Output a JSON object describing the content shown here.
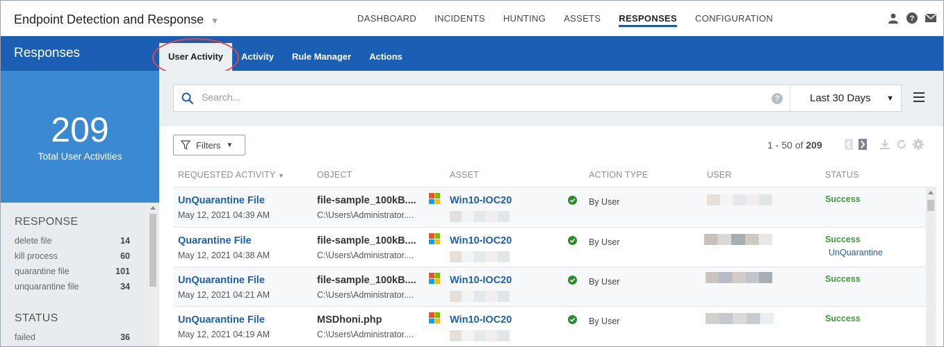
{
  "app": {
    "title": "Endpoint Detection and Response"
  },
  "topnav": [
    "DASHBOARD",
    "INCIDENTS",
    "HUNTING",
    "ASSETS",
    "RESPONSES",
    "CONFIGURATION"
  ],
  "topnav_active": "RESPONSES",
  "top_icons": [
    "user-icon",
    "help-icon",
    "mail-icon"
  ],
  "section": {
    "title": "Responses"
  },
  "subtabs": [
    "User Activity",
    "Activity",
    "Rule Manager",
    "Actions"
  ],
  "subtab_active": "User Activity",
  "stats": {
    "count": "209",
    "label": "Total User Activities"
  },
  "facets": {
    "response": {
      "title": "RESPONSE",
      "items": [
        {
          "label": "delete file",
          "count": "14"
        },
        {
          "label": "kill process",
          "count": "60"
        },
        {
          "label": "quarantine file",
          "count": "101"
        },
        {
          "label": "unquarantine file",
          "count": "34"
        }
      ]
    },
    "status": {
      "title": "STATUS",
      "items": [
        {
          "label": "failed",
          "count": "36"
        }
      ]
    }
  },
  "search": {
    "placeholder": "Search...",
    "value": "",
    "date_range": "Last 30 Days"
  },
  "toolbar": {
    "filters_label": "Filters",
    "pager_text": "1 - 50 of",
    "pager_total": "209"
  },
  "columns": [
    "REQUESTED ACTIVITY",
    "OBJECT",
    "ASSET",
    "ACTION TYPE",
    "USER",
    "STATUS"
  ],
  "rows": [
    {
      "activity": "UnQuarantine File",
      "date": "May 12, 2021 04:39 AM",
      "object": "file-sample_100kB....",
      "path": "C:\\Users\\Administrator....",
      "asset": "Win10-IOC20",
      "action_type": "By User",
      "status": "Success",
      "status_sub": ""
    },
    {
      "activity": "Quarantine File",
      "date": "May 12, 2021 04:38 AM",
      "object": "file-sample_100kB....",
      "path": "C:\\Users\\Administrator....",
      "asset": "Win10-IOC20",
      "action_type": "By User",
      "status": "Success",
      "status_sub": "UnQuarantine"
    },
    {
      "activity": "UnQuarantine File",
      "date": "May 12, 2021 04:21 AM",
      "object": "file-sample_100kB....",
      "path": "C:\\Users\\Administrator....",
      "asset": "Win10-IOC20",
      "action_type": "By User",
      "status": "Success",
      "status_sub": ""
    },
    {
      "activity": "UnQuarantine File",
      "date": "May 12, 2021 04:19 AM",
      "object": "MSDhoni.php",
      "path": "C:\\Users\\Administrator....",
      "asset": "Win10-IOC20",
      "action_type": "By User",
      "status": "Success",
      "status_sub": ""
    }
  ],
  "colors": {
    "brand_blue": "#1a5fb4",
    "stat_blue": "#3b8ad1",
    "success_green": "#3d9b3d",
    "annotation_red": "#e0474c"
  }
}
